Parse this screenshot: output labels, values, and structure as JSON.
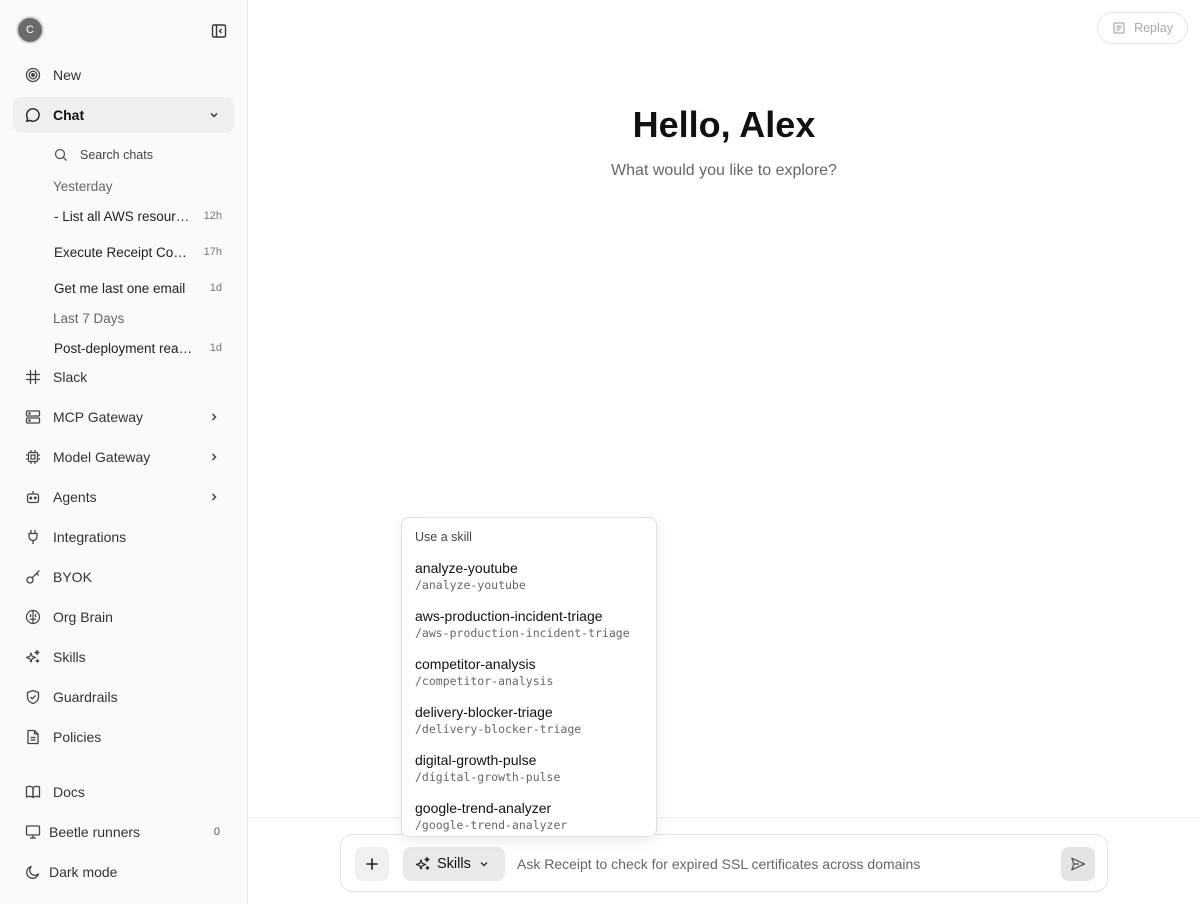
{
  "sidebar": {
    "avatar_initial": "C",
    "nav_top": [
      {
        "label": "New",
        "icon": "target-icon"
      }
    ],
    "chat": {
      "label": "Chat",
      "icon": "chat-bubble-icon"
    },
    "search_placeholder": "Search chats",
    "groups": [
      {
        "label": "Yesterday"
      },
      {
        "label": "Last 7 Days"
      }
    ],
    "chats": [
      {
        "title": "- List all AWS resources",
        "time": "12h"
      },
      {
        "title": "Execute Receipt Confirmation",
        "time": "17h"
      },
      {
        "title": "Get me last one email",
        "time": "1d"
      },
      {
        "title": "Post-deployment readiness",
        "time": "1d"
      }
    ],
    "nav": [
      {
        "label": "Slack",
        "icon": "slack-icon"
      },
      {
        "label": "MCP Gateway",
        "icon": "server-icon"
      },
      {
        "label": "Model Gateway",
        "icon": "cpu-icon"
      },
      {
        "label": "Agents",
        "icon": "bot-icon"
      },
      {
        "label": "Integrations",
        "icon": "plug-icon"
      },
      {
        "label": "BYOK",
        "icon": "key-icon"
      },
      {
        "label": "Org Brain",
        "icon": "brain-icon"
      },
      {
        "label": "Skills",
        "icon": "sparkles-icon"
      },
      {
        "label": "Guardrails",
        "icon": "shield-icon"
      },
      {
        "label": "Policies",
        "icon": "file-icon"
      }
    ],
    "bottom": [
      {
        "label": "Docs",
        "icon": "book-icon"
      },
      {
        "label": "Beetle runners",
        "icon": "monitor-icon",
        "badge": "0"
      },
      {
        "label": "Dark mode",
        "icon": "moon-icon"
      }
    ]
  },
  "header": {
    "replay_label": "Replay"
  },
  "hero": {
    "title": "Hello, Alex",
    "subtitle": "What would you like to explore?"
  },
  "skill_menu": {
    "header": "Use a skill",
    "items": [
      {
        "name": "analyze-youtube",
        "command": "/analyze-youtube"
      },
      {
        "name": "aws-production-incident-triage",
        "command": "/aws-production-incident-triage"
      },
      {
        "name": "competitor-analysis",
        "command": "/competitor-analysis"
      },
      {
        "name": "delivery-blocker-triage",
        "command": "/delivery-blocker-triage"
      },
      {
        "name": "digital-growth-pulse",
        "command": "/digital-growth-pulse"
      },
      {
        "name": "google-trend-analyzer",
        "command": "/google-trend-analyzer"
      }
    ]
  },
  "composer": {
    "skills_label": "Skills",
    "placeholder": "Ask Receipt to check for expired SSL certificates across domains"
  }
}
